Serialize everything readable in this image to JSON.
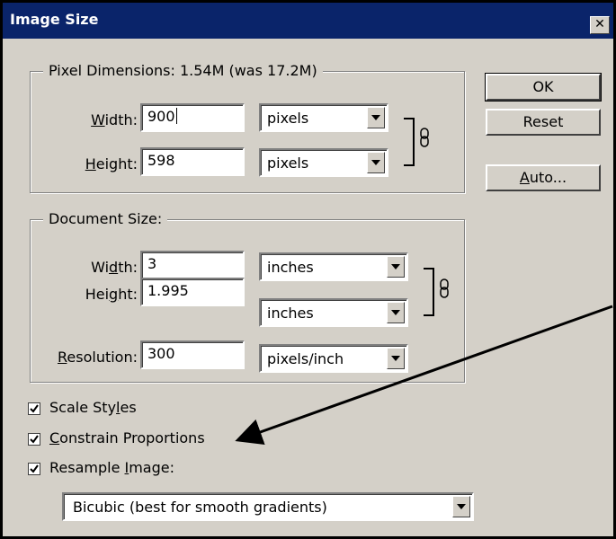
{
  "window": {
    "title": "Image Size"
  },
  "pixel_dimensions": {
    "legend": "Pixel Dimensions:  1.54M (was 17.2M)",
    "width": {
      "label_pre": "",
      "label_ul": "W",
      "label_post": "idth:",
      "value": "900",
      "unit": "pixels"
    },
    "height": {
      "label_pre": "",
      "label_ul": "H",
      "label_post": "eight:",
      "value": "598",
      "unit": "pixels"
    }
  },
  "document_size": {
    "legend": "Document Size:",
    "width": {
      "label_pre": "Wi",
      "label_ul": "d",
      "label_post": "th:",
      "value": "3",
      "unit": "inches"
    },
    "height": {
      "label_pre": "Hei",
      "label_ul": "g",
      "label_post": "ht:",
      "value": "1.995",
      "unit": "inches"
    },
    "resolution": {
      "label_pre": "",
      "label_ul": "R",
      "label_post": "esolution:",
      "value": "300",
      "unit": "pixels/inch"
    }
  },
  "buttons": {
    "ok": "OK",
    "reset": "Reset",
    "auto_ul": "A",
    "auto_post": "uto..."
  },
  "options": {
    "scale_styles": {
      "pre": "Scale Sty",
      "ul": "l",
      "post": "es",
      "checked": true
    },
    "constrain": {
      "pre": "",
      "ul": "C",
      "post": "onstrain Proportions",
      "checked": true
    },
    "resample": {
      "pre": "Resample ",
      "ul": "I",
      "post": "mage:",
      "checked": true
    }
  },
  "resample_method": "Bicubic (best for smooth gradients)",
  "icons": {
    "link": "chain-link-icon",
    "dropdown": "chevron-down-icon",
    "close": "close-icon",
    "check": "check-icon"
  }
}
